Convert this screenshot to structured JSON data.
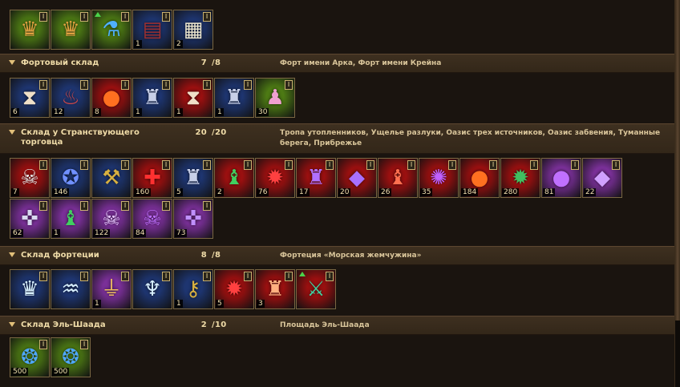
{
  "sections": [
    {
      "title": "",
      "count": "",
      "max": "",
      "location": "",
      "items": [
        {
          "icon": "crown-icon",
          "glyph": "♛",
          "bg": "#4d7a14",
          "fg": "#e0a040",
          "qty": "",
          "upgrade": false
        },
        {
          "icon": "crown-icon",
          "glyph": "♛",
          "bg": "#4d7a14",
          "fg": "#e0a040",
          "qty": "",
          "upgrade": false
        },
        {
          "icon": "potion-flask-icon",
          "glyph": "⚗",
          "bg": "#4d7a14",
          "fg": "#4fb0ff",
          "qty": "",
          "upgrade": true
        },
        {
          "icon": "book-icon",
          "glyph": "▤",
          "bg": "#1e3570",
          "fg": "#a03030",
          "qty": "1",
          "upgrade": false
        },
        {
          "icon": "scroll-icon",
          "glyph": "▦",
          "bg": "#1e3570",
          "fg": "#eee8d0",
          "qty": "2",
          "upgrade": false
        }
      ]
    },
    {
      "title": "Фортовый склад",
      "count": "7",
      "max": "/8",
      "location": "Форт имени Арка, Форт имени Крейна",
      "items": [
        {
          "icon": "hourglass-icon",
          "glyph": "⧗",
          "bg": "#1e3570",
          "fg": "#f0e0c8",
          "qty": "6",
          "upgrade": false
        },
        {
          "icon": "elixir-bottle-icon",
          "glyph": "♨",
          "bg": "#1e3570",
          "fg": "#d04848",
          "qty": "12",
          "upgrade": false
        },
        {
          "icon": "fire-orb-icon",
          "glyph": "●",
          "bg": "#9a1010",
          "fg": "#ff7020",
          "qty": "8",
          "upgrade": false
        },
        {
          "icon": "potion-bottle-icon",
          "glyph": "♜",
          "bg": "#1e3570",
          "fg": "#c8d0e8",
          "qty": "1",
          "upgrade": false
        },
        {
          "icon": "hourglass-icon",
          "glyph": "⧗",
          "bg": "#9a1010",
          "fg": "#f0e0c8",
          "qty": "1",
          "upgrade": false
        },
        {
          "icon": "potion-bottle-icon",
          "glyph": "♜",
          "bg": "#1e3570",
          "fg": "#c8d0e8",
          "qty": "1",
          "upgrade": false
        },
        {
          "icon": "pink-potion-icon",
          "glyph": "♟",
          "bg": "#4d7a14",
          "fg": "#f0a0d0",
          "qty": "30",
          "upgrade": false
        }
      ]
    },
    {
      "title": "Склад у Странствующего торговца",
      "count": "20",
      "max": "/20",
      "location": "Тропа утопленников, Ущелье разлуки, Оазис трех источников, Оазис забвения, Туманные берега, Прибрежье",
      "items": [
        {
          "icon": "skull-potion-icon",
          "glyph": "☠",
          "bg": "#9a1010",
          "fg": "#e8e8e8",
          "qty": "7",
          "upgrade": false
        },
        {
          "icon": "star-orb-icon",
          "glyph": "✪",
          "bg": "#1e3570",
          "fg": "#7090ff",
          "qty": "146",
          "upgrade": false
        },
        {
          "icon": "hammer-icon",
          "glyph": "⚒",
          "bg": "#1e3570",
          "fg": "#d8b040",
          "qty": "",
          "upgrade": false
        },
        {
          "icon": "red-cross-icon",
          "glyph": "✚",
          "bg": "#9a1010",
          "fg": "#ff3030",
          "qty": "160",
          "upgrade": false
        },
        {
          "icon": "potion-bottle-icon",
          "glyph": "♜",
          "bg": "#1e3570",
          "fg": "#c8d0e8",
          "qty": "5",
          "upgrade": false
        },
        {
          "icon": "green-potion-icon",
          "glyph": "♝",
          "bg": "#9a1010",
          "fg": "#40d060",
          "qty": "2",
          "upgrade": false
        },
        {
          "icon": "red-gem-icon",
          "glyph": "✹",
          "bg": "#9a1010",
          "fg": "#ff4040",
          "qty": "76",
          "upgrade": false
        },
        {
          "icon": "purple-potion-icon",
          "glyph": "♜",
          "bg": "#9a1010",
          "fg": "#b070ff",
          "qty": "17",
          "upgrade": false
        },
        {
          "icon": "purple-crystal-icon",
          "glyph": "◆",
          "bg": "#9a1010",
          "fg": "#a870ff",
          "qty": "20",
          "upgrade": false
        },
        {
          "icon": "red-potion-icon",
          "glyph": "♝",
          "bg": "#9a1010",
          "fg": "#ff7050",
          "qty": "26",
          "upgrade": false
        },
        {
          "icon": "purple-rune-icon",
          "glyph": "✺",
          "bg": "#9a1010",
          "fg": "#c060ff",
          "qty": "35",
          "upgrade": false
        },
        {
          "icon": "fire-orb-icon",
          "glyph": "●",
          "bg": "#9a1010",
          "fg": "#ff7020",
          "qty": "184",
          "upgrade": false
        },
        {
          "icon": "green-orb-icon",
          "glyph": "✹",
          "bg": "#9a1010",
          "fg": "#40c060",
          "qty": "280",
          "upgrade": false
        },
        {
          "icon": "purple-orb-icon",
          "glyph": "●",
          "bg": "#7a3098",
          "fg": "#c070ff",
          "qty": "81",
          "upgrade": false
        },
        {
          "icon": "purple-crystal-icon",
          "glyph": "◆",
          "bg": "#7a3098",
          "fg": "#d0a0ff",
          "qty": "22",
          "upgrade": false
        },
        {
          "icon": "silver-cross-icon",
          "glyph": "✜",
          "bg": "#7a3098",
          "fg": "#d8d8f0",
          "qty": "62",
          "upgrade": false
        },
        {
          "icon": "green-potion-icon",
          "glyph": "♝",
          "bg": "#7a3098",
          "fg": "#40d060",
          "qty": "1",
          "upgrade": false
        },
        {
          "icon": "purple-skull-icon",
          "glyph": "☠",
          "bg": "#7a3098",
          "fg": "#e8c8ff",
          "qty": "122",
          "upgrade": false
        },
        {
          "icon": "purple-skull-icon",
          "glyph": "☠",
          "bg": "#7a3098",
          "fg": "#c070ff",
          "qty": "84",
          "upgrade": false
        },
        {
          "icon": "purple-cross-icon",
          "glyph": "✜",
          "bg": "#7a3098",
          "fg": "#c090ff",
          "qty": "73",
          "upgrade": false
        }
      ]
    },
    {
      "title": "Склад фортеции",
      "count": "8",
      "max": "/8",
      "location": "Фортеция «Морская жемчужина»",
      "items": [
        {
          "icon": "stone-rune-icon",
          "glyph": "♛",
          "bg": "#1e3570",
          "fg": "#d8f0ff",
          "qty": "",
          "upgrade": false
        },
        {
          "icon": "stone-rune-icon",
          "glyph": "♒",
          "bg": "#1e3570",
          "fg": "#d8f0ff",
          "qty": "",
          "upgrade": false
        },
        {
          "icon": "goblet-icon",
          "glyph": "⏚",
          "bg": "#7a3098",
          "fg": "#f0c060",
          "qty": "1",
          "upgrade": false
        },
        {
          "icon": "goblet-stone-icon",
          "glyph": "♆",
          "bg": "#1e3570",
          "fg": "#d8f0ff",
          "qty": "",
          "upgrade": false
        },
        {
          "icon": "key-icon",
          "glyph": "⚷",
          "bg": "#1e3570",
          "fg": "#d8b040",
          "qty": "1",
          "upgrade": false
        },
        {
          "icon": "red-gem-icon",
          "glyph": "✹",
          "bg": "#9a1010",
          "fg": "#ff4040",
          "qty": "5",
          "upgrade": false
        },
        {
          "icon": "red-lantern-icon",
          "glyph": "♜",
          "bg": "#9a1010",
          "fg": "#ffb080",
          "qty": "3",
          "upgrade": false
        },
        {
          "icon": "spear-icon",
          "glyph": "⚔",
          "bg": "#9a1010",
          "fg": "#40d0a0",
          "qty": "",
          "upgrade": true
        }
      ]
    },
    {
      "title": "Склад Эль-Шаада",
      "count": "2",
      "max": "/10",
      "location": "Площадь Эль-Шаада",
      "items": [
        {
          "icon": "blue-rune-orb-icon",
          "glyph": "❂",
          "bg": "#4d7a14",
          "fg": "#4fa8ff",
          "qty": "500",
          "upgrade": false
        },
        {
          "icon": "blue-rune-orb-icon",
          "glyph": "❂",
          "bg": "#4d7a14",
          "fg": "#4fa8ff",
          "qty": "500",
          "upgrade": false
        }
      ]
    }
  ]
}
